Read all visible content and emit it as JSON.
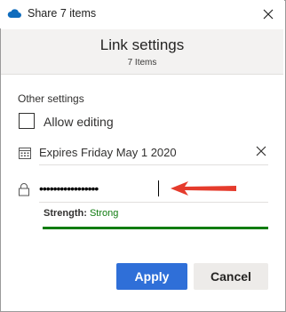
{
  "window": {
    "title": "Share 7 items",
    "app_icon": "onedrive-cloud-icon",
    "close_icon": "close-icon"
  },
  "header": {
    "title": "Link settings",
    "subtitle": "7 Items"
  },
  "settings": {
    "section_label": "Other settings",
    "allow_editing": {
      "label": "Allow editing",
      "checked": false
    },
    "expiry": {
      "icon": "calendar-icon",
      "text": "Expires Friday May 1 2020",
      "clear_icon": "close-icon"
    },
    "password": {
      "icon": "lock-icon",
      "masked_value": "•••••••••••••••••",
      "annotation": "red-arrow-icon"
    },
    "strength": {
      "label": "Strength:",
      "value": "Strong",
      "level": 1.0,
      "color": "#107c10"
    }
  },
  "buttons": {
    "apply_label": "Apply",
    "cancel_label": "Cancel",
    "apply_color": "#2f6fd8"
  }
}
